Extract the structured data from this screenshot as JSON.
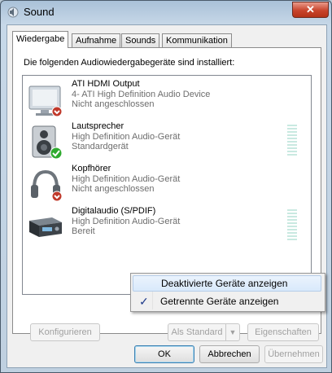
{
  "window": {
    "title": "Sound",
    "close_label": "✕"
  },
  "tabs": [
    {
      "label": "Wiedergabe"
    },
    {
      "label": "Aufnahme"
    },
    {
      "label": "Sounds"
    },
    {
      "label": "Kommunikation"
    }
  ],
  "intro": "Die folgenden Audiowiedergabegeräte sind installiert:",
  "devices": [
    {
      "name": "ATI HDMI Output",
      "driver": "4- ATI High Definition Audio Device",
      "status": "Nicht angeschlossen",
      "icon": "monitor-icon",
      "badge": "disconnected-arrow"
    },
    {
      "name": "Lautsprecher",
      "driver": "High Definition Audio-Gerät",
      "status": "Standardgerät",
      "icon": "speaker-icon",
      "badge": "default-check"
    },
    {
      "name": "Kopfhörer",
      "driver": "High Definition Audio-Gerät",
      "status": "Nicht angeschlossen",
      "icon": "headphones-icon",
      "badge": "disconnected-arrow"
    },
    {
      "name": "Digitalaudio (S/PDIF)",
      "driver": "High Definition Audio-Gerät",
      "status": "Bereit",
      "icon": "digital-receiver-icon",
      "badge": ""
    }
  ],
  "buttons": {
    "configure": "Konfigurieren",
    "set_default": "Als Standard",
    "properties": "Eigenschaften",
    "ok": "OK",
    "cancel": "Abbrechen",
    "apply": "Übernehmen"
  },
  "context_menu": [
    {
      "label": "Deaktivierte Geräte anzeigen",
      "checked": false
    },
    {
      "label": "Getrennte Geräte anzeigen",
      "checked": true
    }
  ],
  "colors": {
    "accent": "#3c7fb1",
    "check_green": "#2faa2f",
    "disconnected_red": "#c0392b"
  }
}
